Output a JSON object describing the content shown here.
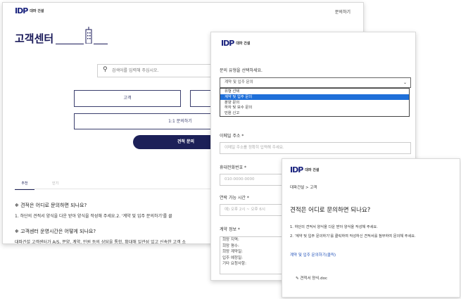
{
  "brand": {
    "mark": "IDP",
    "name": "대파 건설"
  },
  "main": {
    "header_link": "문의하기",
    "title": "고객센터",
    "search_placeholder": "검색어를 입력해 주십시오.",
    "btn_customer": "고객",
    "btn_inquiry": "1:1 문의하기",
    "btn_quote": "견적 문의",
    "tabs": [
      {
        "label": "추천"
      },
      {
        "label": "인기"
      }
    ],
    "faq": [
      {
        "q": "견적은 어디로 문의하면 되나요?",
        "a": "1. 하단의 견적서 양식을 다운 받아 양식을 작성해 주세요.2. '계약 및 입주 문의하기'를 클"
      },
      {
        "q": "고객센터 운영시간은 어떻게 되나요?",
        "a": "대파건설 고객센터가 A/S, 분양, 계약, 민원 등의 상담을 통합, 확대해 일관성 있고 신속한 고객 소"
      }
    ]
  },
  "form": {
    "inquiry_type_label": "문의 유형을 선택하세요.",
    "inquiry_type_value": "계약 및 입주 문의",
    "options": [
      "유형 선택",
      "계약 및 입주 문의",
      "분양 문의",
      "하자 및 보수 문의",
      "민원 신고"
    ],
    "selected_index": 1,
    "email_label": "이메일 주소 *",
    "email_placeholder": "이메일 주소를 정확히 입력해 주세요.",
    "phone_label": "휴대전화번호 *",
    "phone_placeholder": "010-0000-0000",
    "time_label": "연락 가능 시간 *",
    "time_placeholder": "예) 오후 2시 ~ 오후 6시",
    "contract_label": "계약 정보 *",
    "contract_lines": [
      "희망 지역:",
      "희망 평수:",
      "희망 계약일:",
      "입주 예정일:",
      "기타 요청사항:"
    ]
  },
  "detail": {
    "breadcrumb": "대파건설 > 고객",
    "title": "견적은 어디로 문의하면 되나요?",
    "line1": "1. 하단의 견적서 양식을 다운 받아 양식을 작성해 주세요.",
    "line2": "2. '계약 및 입주 문의하기'를 클릭하여 작성하신 견적서를 첨부하여 문의해 주세요.",
    "link": "계약 및 입주 문의하기(클릭)",
    "file": "견적서 양식.doc"
  }
}
